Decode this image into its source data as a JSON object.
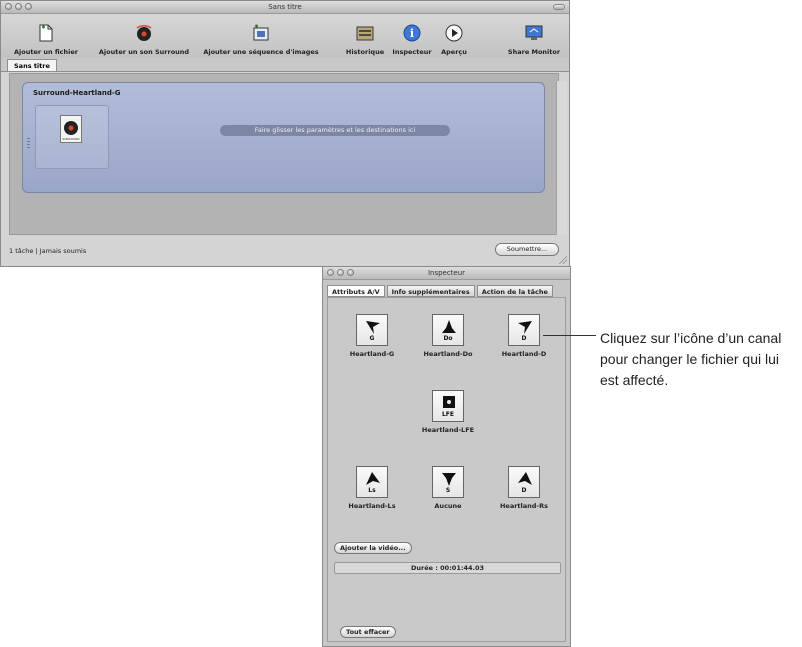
{
  "main_window": {
    "title": "Sans titre",
    "toolbar": [
      {
        "label": "Ajouter un fichier",
        "icon": "add-file-icon"
      },
      {
        "label": "Ajouter un son Surround",
        "icon": "add-surround-icon"
      },
      {
        "label": "Ajouter une séquence d'images",
        "icon": "add-image-sequence-icon"
      },
      {
        "label": "Historique",
        "icon": "history-icon"
      },
      {
        "label": "Inspecteur",
        "icon": "info-icon"
      },
      {
        "label": "Aperçu",
        "icon": "play-icon"
      },
      {
        "label": "Share Monitor",
        "icon": "monitor-icon"
      }
    ],
    "tab": "Sans titre",
    "batch": {
      "title": "Surround-Heartland-G",
      "file_icon_label": "SURROUND",
      "drop_hint": "Faire glisser les paramètres et les destinations ici"
    },
    "status": "1 tâche  |  Jamais soumis",
    "submit_button": "Soumettre..."
  },
  "inspector": {
    "title": "Inspecteur",
    "tabs": [
      "Attributs A/V",
      "Info supplémentaires",
      "Action de la tâche"
    ],
    "channels": [
      {
        "code": "G",
        "file": "Heartland-G",
        "icon": "speaker-left-icon"
      },
      {
        "code": "Do",
        "file": "Heartland-Do",
        "icon": "speaker-center-icon"
      },
      {
        "code": "D",
        "file": "Heartland-D",
        "icon": "speaker-right-icon"
      },
      {
        "code": "LFE",
        "file": "Heartland-LFE",
        "icon": "subwoofer-icon"
      },
      {
        "code": "Ls",
        "file": "Heartland-Ls",
        "icon": "speaker-left-surround-icon"
      },
      {
        "code": "S",
        "file": "Aucune",
        "icon": "speaker-surround-icon"
      },
      {
        "code": "D",
        "file": "Heartland-Rs",
        "icon": "speaker-right-surround-icon"
      }
    ],
    "add_video_button": "Ajouter la vidéo...",
    "duration": "Durée : 00:01:44.03",
    "clear_all_button": "Tout effacer"
  },
  "callout": "Cliquez sur l’icône d’un canal pour changer le fichier qui lui est affecté."
}
